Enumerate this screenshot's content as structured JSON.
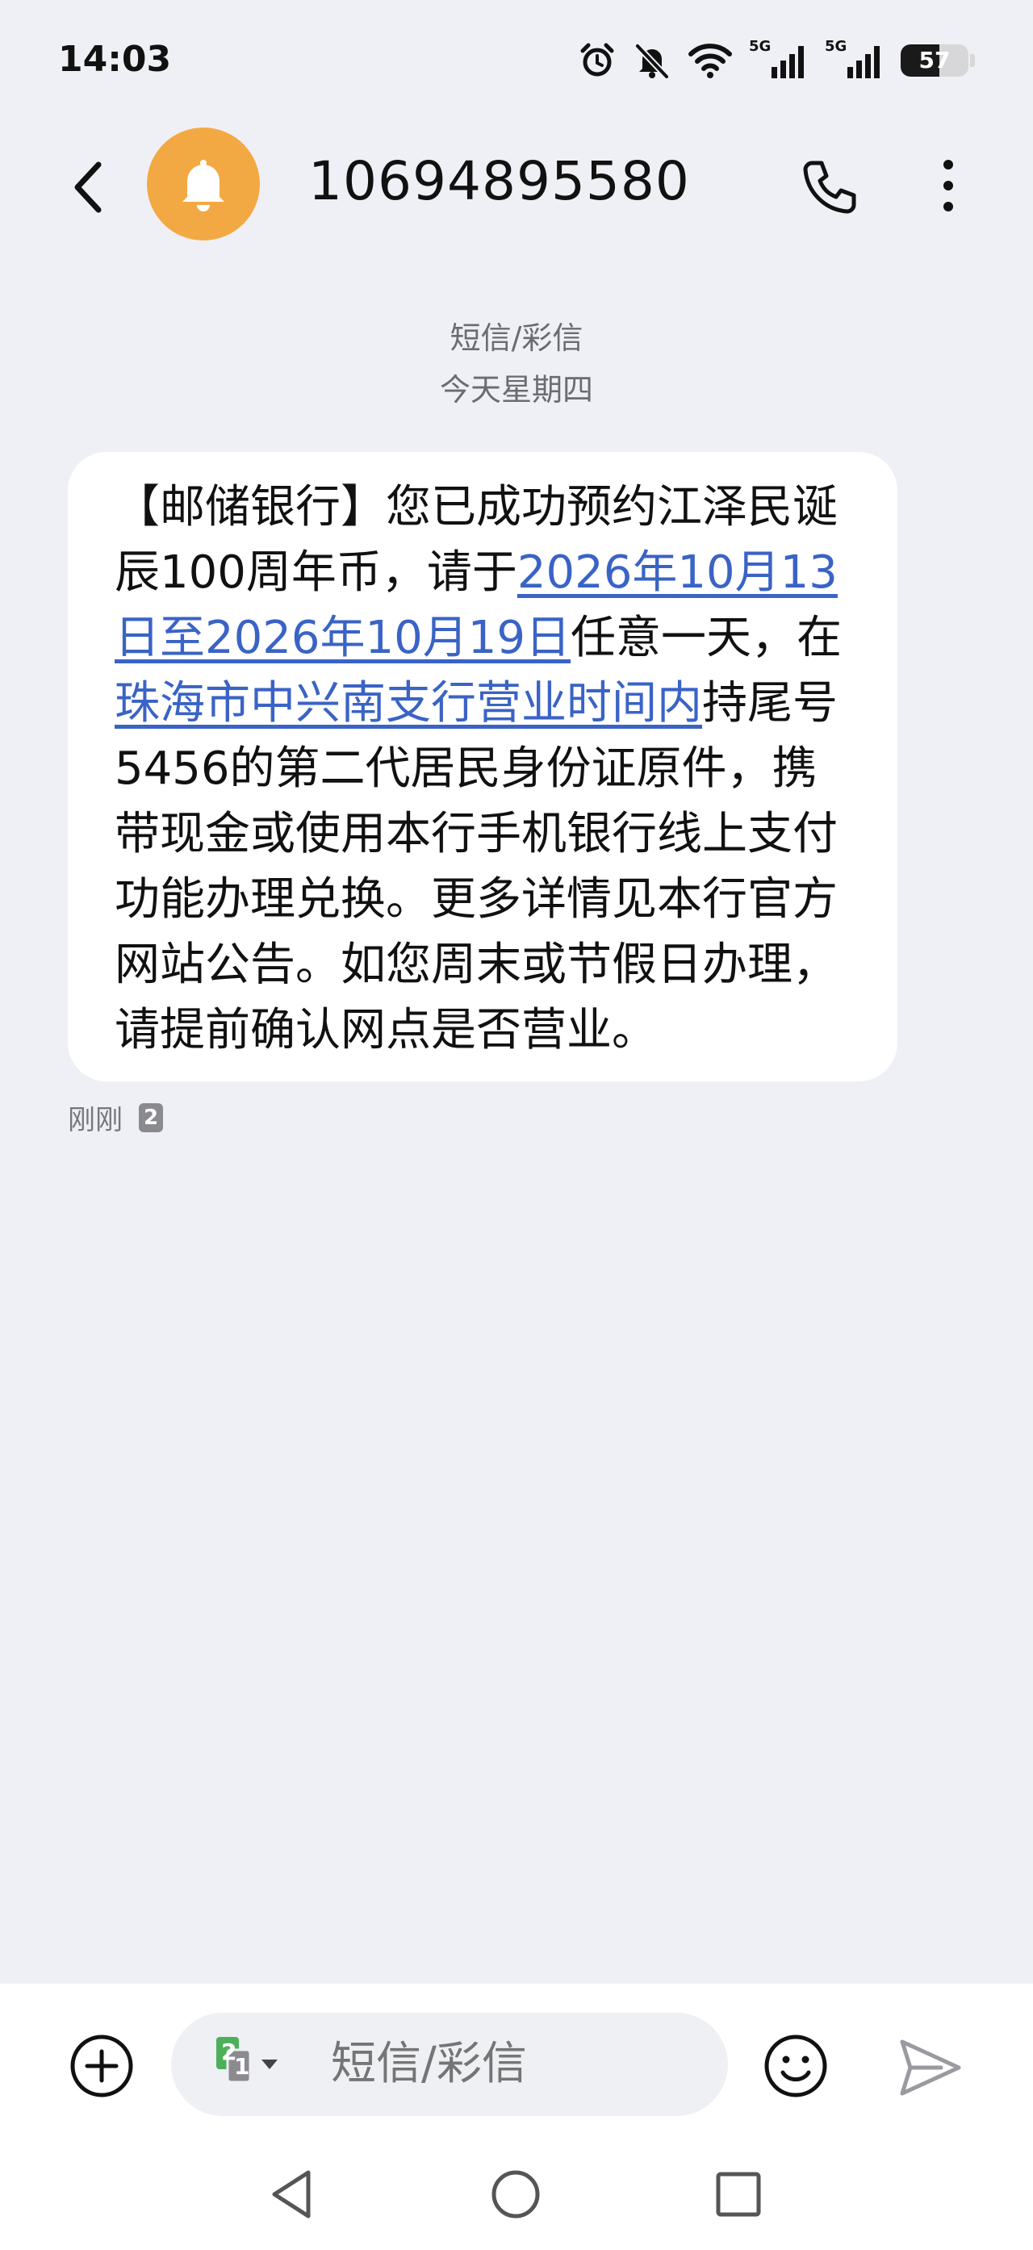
{
  "status_bar": {
    "time": "14:03",
    "network1": "5G",
    "network2": "5G",
    "battery_percent": 57,
    "battery_label": "57",
    "icons": [
      "alarm-icon",
      "mute-icon",
      "wifi-icon",
      "signal-icon",
      "signal-icon",
      "battery-icon"
    ]
  },
  "header": {
    "contact_number": "10694895580",
    "avatar_icon": "bell-icon",
    "back_icon": "chevron-left-icon",
    "call_icon": "phone-icon",
    "more_icon": "more-vertical-icon",
    "avatar_color": "#F3A943"
  },
  "thread": {
    "message_type": "短信/彩信",
    "date_label": "今天星期四"
  },
  "message": {
    "part1": "【邮储银行】您已成功预约江泽民诞辰100周年币，请于",
    "link_date": "2026年10月13日至2026年10月19日",
    "part2": "任意一天，在",
    "link_place": "珠海市中兴南支行营业时间内",
    "part3": "持尾号5456的第二代居民身份证原件，携带现金或使用本行手机银行线上支付功能办理兑换。更多详情见本行官方网站公告。如您周末或节假日办理，请提前确认网点是否营业。",
    "time_label": "刚刚",
    "sim_slot": "2",
    "link_color": "#3A63C6"
  },
  "composer": {
    "placeholder": "短信/彩信",
    "sim_primary": "2",
    "sim_secondary": "1",
    "add_icon": "plus-circle-icon",
    "emoji_icon": "smiley-icon",
    "send_icon": "send-icon"
  },
  "nav": {
    "icons": [
      "nav-back-icon",
      "nav-home-icon",
      "nav-recent-icon"
    ]
  }
}
